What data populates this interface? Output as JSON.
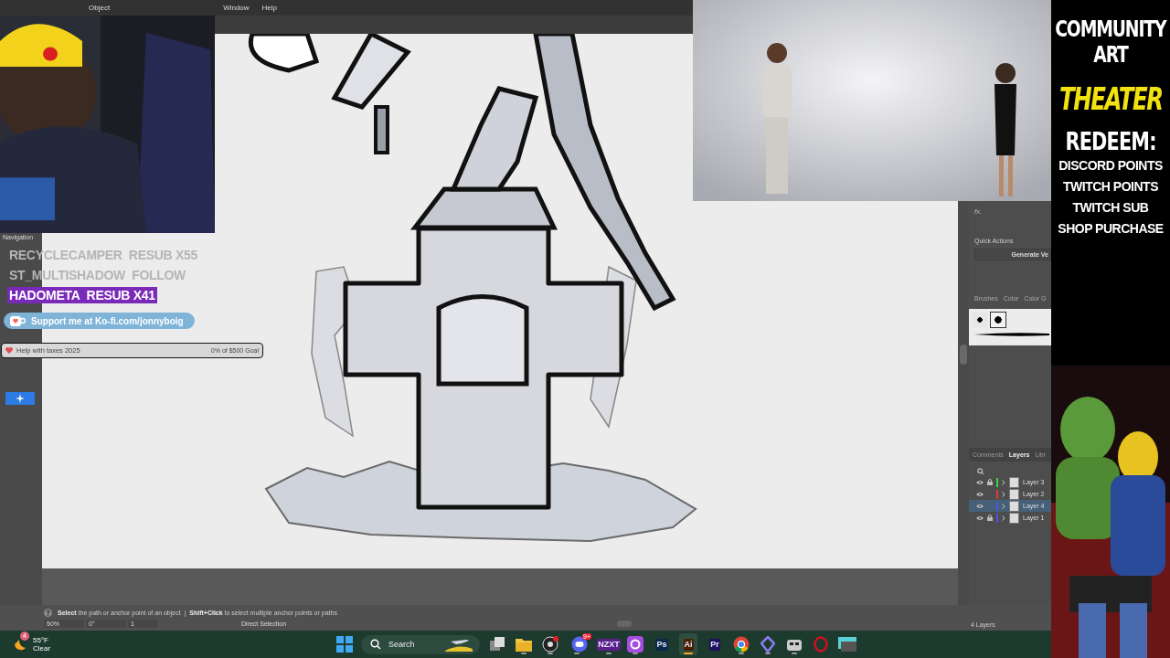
{
  "menu": [
    {
      "label": "Object"
    },
    {
      "label": "Window"
    },
    {
      "label": "Help"
    }
  ],
  "tool_strip": {
    "label": "Navigation"
  },
  "alerts": [
    {
      "name": "RECYCLECAMPER",
      "event": "RESUB X55",
      "highlighted": false
    },
    {
      "name": "ST_MULTISHADOW",
      "event": "FOLLOW",
      "highlighted": false
    },
    {
      "name": "HADOMETA",
      "event": "RESUB X41",
      "highlighted": true
    }
  ],
  "kofi": {
    "label": "Support me at Ko-fi.com/jonnyboig"
  },
  "goal": {
    "title": "Help with taxes 2025",
    "progress": "0% of $500 Goal",
    "level": 0
  },
  "properties": {
    "fx": "fx.",
    "quick_actions": "Quick Actions",
    "button": "Generate Ve"
  },
  "brush_tabs": [
    {
      "label": "Brushes"
    },
    {
      "label": "Color"
    },
    {
      "label": "Color G"
    }
  ],
  "layer_tabs": [
    {
      "label": "Comments",
      "selected": false
    },
    {
      "label": "Layers",
      "selected": true
    },
    {
      "label": "Libr",
      "selected": false
    }
  ],
  "layers": [
    {
      "name": "Layer 3",
      "color": "#3fd13f",
      "locked": true,
      "selected": false
    },
    {
      "name": "Layer 2",
      "color": "#d13f3f",
      "locked": false,
      "selected": false
    },
    {
      "name": "Layer 4",
      "color": "#4f4fe0",
      "locked": false,
      "selected": true
    },
    {
      "name": "Layer 1",
      "color": "#4f4fe0",
      "locked": true,
      "selected": false
    }
  ],
  "layer_count": "4 Layers",
  "status": {
    "hint": "**Select** the path or anchor point of an object  |  **Shift+Click** to select multiple anchor points or paths",
    "zoom": "50%",
    "rotation": "0°",
    "artboard": "1",
    "tool": "Direct Selection"
  },
  "weather": {
    "temp": "55°F",
    "condition": "Clear",
    "badge": "4"
  },
  "taskbar_search": {
    "placeholder": "Search"
  },
  "apps": [
    {
      "kind": "task-view",
      "running": false,
      "selected": false
    },
    {
      "kind": "folder",
      "running": true,
      "selected": false
    },
    {
      "kind": "obs",
      "running": true,
      "selected": false
    },
    {
      "kind": "chat",
      "running": true,
      "selected": false,
      "badge": "9+"
    },
    {
      "kind": "tile",
      "label": "NZXT",
      "color": "#5b1f8a",
      "running": true,
      "selected": false
    },
    {
      "kind": "camera",
      "running": true,
      "selected": false
    },
    {
      "kind": "tile",
      "label": "Ps",
      "color": "#0b2a4a",
      "running": false,
      "selected": false
    },
    {
      "kind": "tile",
      "label": "Ai",
      "color": "#4a2000",
      "running": true,
      "selected": true
    },
    {
      "kind": "tile",
      "label": "Pr",
      "color": "#1f1060",
      "running": false,
      "selected": false
    },
    {
      "kind": "browser",
      "running": true,
      "selected": false
    },
    {
      "kind": "s-logo",
      "running": true,
      "selected": false
    },
    {
      "kind": "robot",
      "running": true,
      "selected": false
    },
    {
      "kind": "ring",
      "running": false,
      "selected": false
    },
    {
      "kind": "monitor",
      "running": false,
      "selected": false
    }
  ],
  "promo": {
    "title": [
      "COMMUNITY",
      "ART"
    ],
    "highlight": "THEATER",
    "redeem": "REDEEM:",
    "options": [
      "DISCORD POINTS",
      "TWITCH POINTS",
      "TWITCH SUB",
      "SHOP PURCHASE"
    ]
  }
}
